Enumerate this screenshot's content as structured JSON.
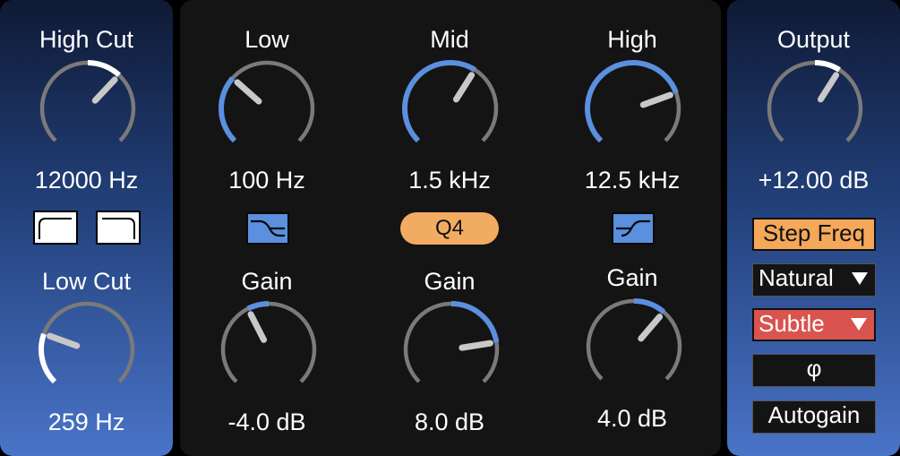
{
  "high_cut": {
    "label": "High Cut",
    "value": "12000 Hz",
    "value_fraction": 0.66
  },
  "filter_types": {
    "high_shelf_icon": "high-cut-filter-icon",
    "low_shelf_icon": "high-shelf-filter-icon"
  },
  "low_cut": {
    "label": "Low Cut",
    "value": "259 Hz",
    "value_fraction": 0.24
  },
  "low": {
    "label": "Low",
    "value": "100 Hz",
    "value_fraction": 0.32,
    "filter_icon": "low-shelf-filter-icon"
  },
  "mid": {
    "label": "Mid",
    "value": "1.5 kHz",
    "value_fraction": 0.62,
    "q_label": "Q4"
  },
  "high": {
    "label": "High",
    "value": "12.5 kHz",
    "value_fraction": 0.76,
    "filter_icon": "high-shelf-split-filter-icon"
  },
  "low_gain": {
    "label": "Gain",
    "value": "-4.0 dB",
    "value_fraction": 0.4
  },
  "mid_gain": {
    "label": "Gain",
    "value": "8.0 dB",
    "value_fraction": 0.8
  },
  "high_gain": {
    "label": "Gain",
    "value": "4.0 dB",
    "value_fraction": 0.65
  },
  "output": {
    "label": "Output",
    "value": "+12.00 dB",
    "value_fraction": 0.62
  },
  "controls": {
    "step_freq": "Step Freq",
    "natural": "Natural",
    "subtle": "Subtle",
    "phase_symbol": "φ",
    "autogain": "Autogain"
  },
  "colors": {
    "accent_blue": "#5b8fe0",
    "knob_track": "#7a7a7a",
    "step_freq_bg": "#f5a85a",
    "subtle_bg": "#d9534f",
    "q_badge_bg": "#f2ac62",
    "filter_icon_bg": "#5a90dd"
  }
}
